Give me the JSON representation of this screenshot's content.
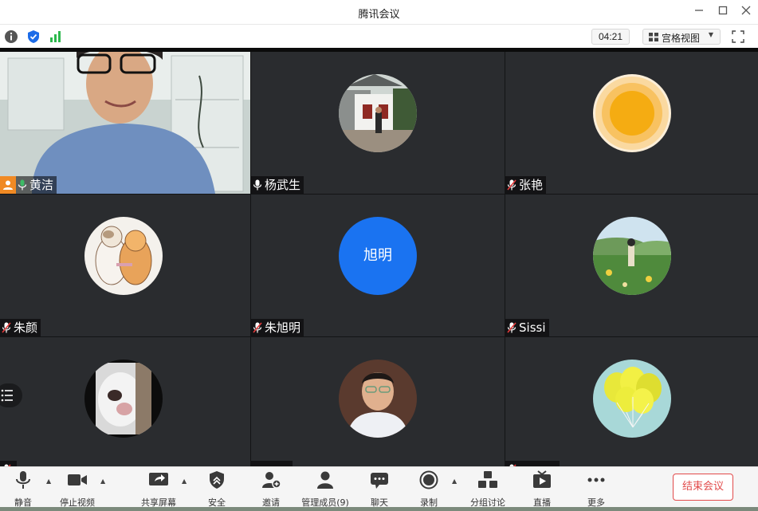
{
  "window": {
    "title": "腾讯会议",
    "minimize_icon": "minimize-icon",
    "maximize_icon": "maximize-icon",
    "close_icon": "close-icon"
  },
  "infobar": {
    "info_icon": "info-icon",
    "security_icon": "shield-icon",
    "signal_icon": "signal-bars-icon",
    "timer": "04:21",
    "view_mode_label": "宫格视图",
    "fullscreen_icon": "fullscreen-icon"
  },
  "participants": [
    {
      "name": "黄洁",
      "mic": "on",
      "host": true,
      "avatar": "camera-video"
    },
    {
      "name": "杨武生",
      "mic": "on",
      "host": false,
      "avatar": "photo-street"
    },
    {
      "name": "张艳",
      "mic": "muted",
      "host": false,
      "avatar": "photo-sun"
    },
    {
      "name": "朱颜",
      "mic": "muted",
      "host": false,
      "avatar": "photo-cats"
    },
    {
      "name": "朱旭明",
      "mic": "muted",
      "host": false,
      "avatar": "text",
      "avatar_text": "旭明"
    },
    {
      "name": "Sissi",
      "mic": "muted",
      "host": false,
      "avatar": "photo-landscape"
    },
    {
      "name": "",
      "mic": "muted",
      "host": false,
      "avatar": "photo-dog"
    },
    {
      "name": "",
      "mic": "muted",
      "host": false,
      "avatar": "photo-man"
    },
    {
      "name": "",
      "mic": "muted",
      "host": false,
      "avatar": "photo-balloons"
    }
  ],
  "toolbar": {
    "mute_label": "静音",
    "stop_video_label": "停止视频",
    "share_screen_label": "共享屏幕",
    "security_label": "安全",
    "invite_label": "邀请",
    "manage_members_label": "管理成员(9)",
    "chat_label": "聊天",
    "record_label": "录制",
    "breakout_label": "分组讨论",
    "live_label": "直播",
    "more_label": "更多",
    "end_meeting_label": "结束会议"
  },
  "colors": {
    "accent_green": "#3dbb66",
    "host_orange": "#f08a24",
    "end_red": "#e24b4b",
    "text_avatar_blue": "#1a73f1",
    "tile_bg": "#2a2c2f"
  }
}
